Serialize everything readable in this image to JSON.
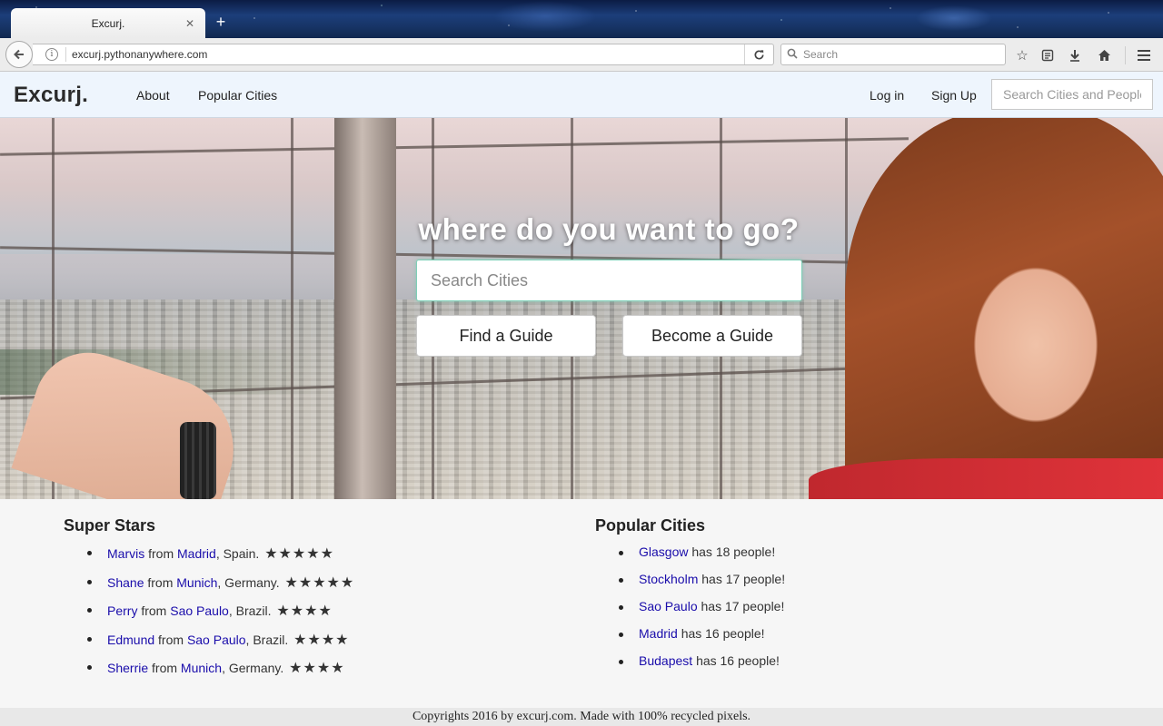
{
  "browser": {
    "tab_title": "Excurj.",
    "tab_close": "✕",
    "new_tab": "+",
    "url": "excurj.pythonanywhere.com",
    "search_placeholder": "Search"
  },
  "site_nav": {
    "brand": "Excurj.",
    "links": [
      "About",
      "Popular Cities"
    ],
    "login": "Log in",
    "signup": "Sign Up",
    "search_placeholder": "Search Cities and People"
  },
  "hero": {
    "title": "where do you want to go?",
    "search_placeholder": "Search Cities",
    "find_guide": "Find a Guide",
    "become_guide": "Become a Guide"
  },
  "super_stars": {
    "title": "Super Stars",
    "items": [
      {
        "name": "Marvis",
        "from": "from",
        "city": "Madrid",
        "country": ", Spain.",
        "stars": "★★★★★"
      },
      {
        "name": "Shane",
        "from": "from",
        "city": "Munich",
        "country": ", Germany.",
        "stars": "★★★★★"
      },
      {
        "name": "Perry",
        "from": "from",
        "city": "Sao Paulo",
        "country": ", Brazil.",
        "stars": "★★★★"
      },
      {
        "name": "Edmund",
        "from": "from",
        "city": "Sao Paulo",
        "country": ", Brazil.",
        "stars": "★★★★"
      },
      {
        "name": "Sherrie",
        "from": "from",
        "city": "Munich",
        "country": ", Germany.",
        "stars": "★★★★"
      }
    ]
  },
  "popular_cities": {
    "title": "Popular Cities",
    "items": [
      {
        "city": "Glasgow",
        "text": "has 18 people!"
      },
      {
        "city": "Stockholm",
        "text": "has 17 people!"
      },
      {
        "city": "Sao Paulo",
        "text": "has 17 people!"
      },
      {
        "city": "Madrid",
        "text": "has 16 people!"
      },
      {
        "city": "Budapest",
        "text": "has 16 people!"
      }
    ]
  },
  "footer": {
    "text": "Copyrights 2016 by excurj.com. Made with 100% recycled pixels."
  },
  "colors": {
    "link": "#1a0dab",
    "nav_bg": "#eef5fd",
    "search_focus": "#7fd0b8"
  }
}
